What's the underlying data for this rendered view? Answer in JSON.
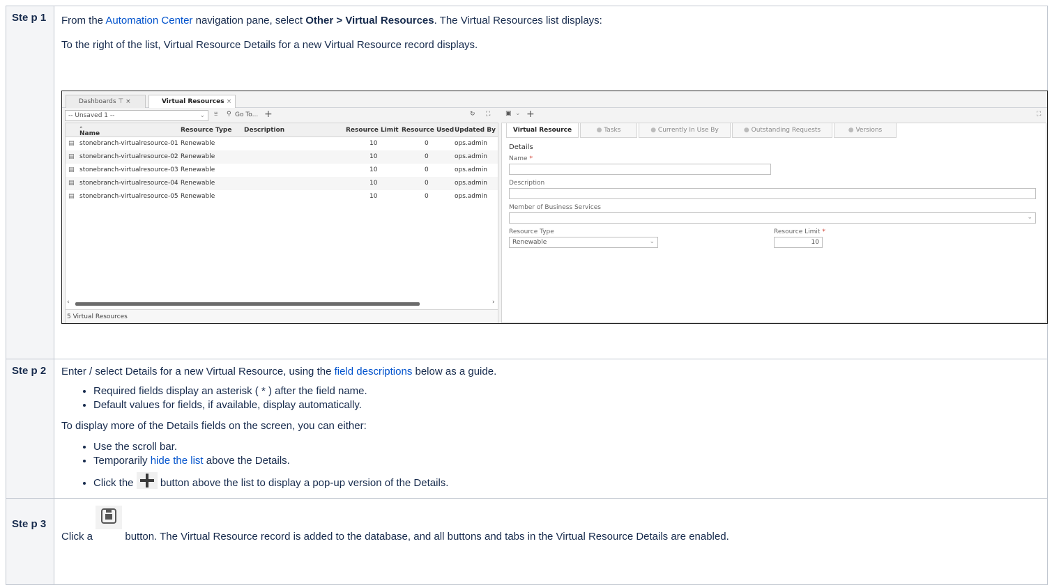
{
  "steps": [
    {
      "label": "Ste p 1",
      "text1_prefix": "From the ",
      "text1_link": "Automation Center",
      "text1_mid": " navigation pane, select ",
      "text1_bold": "Other > Virtual Resources",
      "text1_suffix": ". The Virtual Resources list displays:",
      "text2": "To the right of the list, Virtual Resource Details for a new Virtual Resource record displays."
    },
    {
      "label": "Ste p 2",
      "text1_prefix": "Enter / select Details for a new Virtual Resource, using the ",
      "text1_link": "field descriptions",
      "text1_suffix": " below as a guide.",
      "bullets1": [
        "Required fields display an asterisk ( * ) after the field name.",
        "Default values for fields, if available, display automatically."
      ],
      "text2": "To display more of the Details fields on the screen, you can either:",
      "bullet_scroll": "Use the scroll bar.",
      "bullet_hide_prefix": "Temporarily ",
      "bullet_hide_link": "hide the list",
      "bullet_hide_suffix": " above the Details.",
      "bullet_click_prefix": "Click the ",
      "bullet_click_suffix": " button above the list to display a pop-up version of the Details."
    },
    {
      "label": "Ste p 3",
      "text_prefix": "Click a ",
      "text_suffix": " button. The Virtual Resource record is added to the database, and all buttons and tabs in the Virtual Resource Details are enabled."
    }
  ],
  "screenshot": {
    "tabs": [
      {
        "label": "Dashboards",
        "pin": "⁤",
        "close": "×"
      },
      {
        "label": "Virtual Resources",
        "close": "×"
      }
    ],
    "filter_value": "-- Unsaved 1 --",
    "goto_label": "Go To...",
    "columns": [
      "Name",
      "Resource Type",
      "Description",
      "Resource Limit",
      "Resource Used",
      "Updated By"
    ],
    "rows": [
      {
        "name": "stonebranch-virtualresource-01",
        "type": "Renewable",
        "desc": "",
        "limit": "10",
        "used": "0",
        "by": "ops.admin"
      },
      {
        "name": "stonebranch-virtualresource-02",
        "type": "Renewable",
        "desc": "",
        "limit": "10",
        "used": "0",
        "by": "ops.admin"
      },
      {
        "name": "stonebranch-virtualresource-03",
        "type": "Renewable",
        "desc": "",
        "limit": "10",
        "used": "0",
        "by": "ops.admin"
      },
      {
        "name": "stonebranch-virtualresource-04",
        "type": "Renewable",
        "desc": "",
        "limit": "10",
        "used": "0",
        "by": "ops.admin"
      },
      {
        "name": "stonebranch-virtualresource-05",
        "type": "Renewable",
        "desc": "",
        "limit": "10",
        "used": "0",
        "by": "ops.admin"
      }
    ],
    "list_footer": "5 Virtual Resources",
    "detail_tabs": [
      "Virtual Resource",
      "Tasks",
      "Currently In Use By",
      "Outstanding Requests",
      "Versions"
    ],
    "section_title": "Details",
    "fields": {
      "name_label": "Name",
      "name_value": "",
      "description_label": "Description",
      "description_value": "",
      "business_label": "Member of Business Services",
      "business_value": "",
      "type_label": "Resource Type",
      "type_value": "Renewable",
      "limit_label": "Resource Limit",
      "limit_value": "10"
    },
    "required_mark": "*"
  }
}
